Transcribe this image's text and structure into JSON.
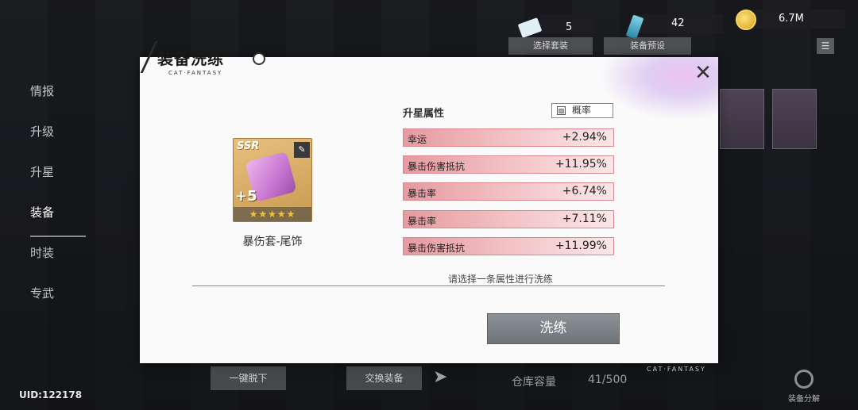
{
  "currencies": {
    "ticket_value": "5",
    "card_value": "42",
    "coin_value": "6.7M"
  },
  "top_buttons": {
    "select_set": "选择套装",
    "equip_preset": "装备预设"
  },
  "side_nav": [
    "情报",
    "升级",
    "升星",
    "装备",
    "时装",
    "专武"
  ],
  "uid": "UID:122178",
  "bottom": {
    "unequip_all": "一键脱下",
    "swap_equip": "交换装备",
    "storage_label": "仓库容量",
    "storage_value": "41/500",
    "decompose_label": "装备分解",
    "brand": "CAT·FANTASY"
  },
  "modal": {
    "title": "装备洗练",
    "title_sub": "CAT·FANTASY",
    "close_glyph": "✕",
    "item": {
      "rarity": "SSR",
      "level": "+5",
      "stars": "★★★★★",
      "name": "暴伤套-尾饰"
    },
    "attr_header": "升星属性",
    "prob_label": "概率",
    "attributes": [
      {
        "name": "幸运",
        "value": "+2.94%"
      },
      {
        "name": "暴击伤害抵抗",
        "value": "+11.95%"
      },
      {
        "name": "暴击率",
        "value": "+6.74%"
      },
      {
        "name": "暴击率",
        "value": "+7.11%"
      },
      {
        "name": "暴击伤害抵抗",
        "value": "+11.99%"
      }
    ],
    "hint": "请选择一条属性进行洗练",
    "refine_button": "洗练"
  },
  "colors": {
    "attr_bar": "#e59aa0",
    "refine_btn": "#7f8488",
    "coin": "#f4c430"
  }
}
